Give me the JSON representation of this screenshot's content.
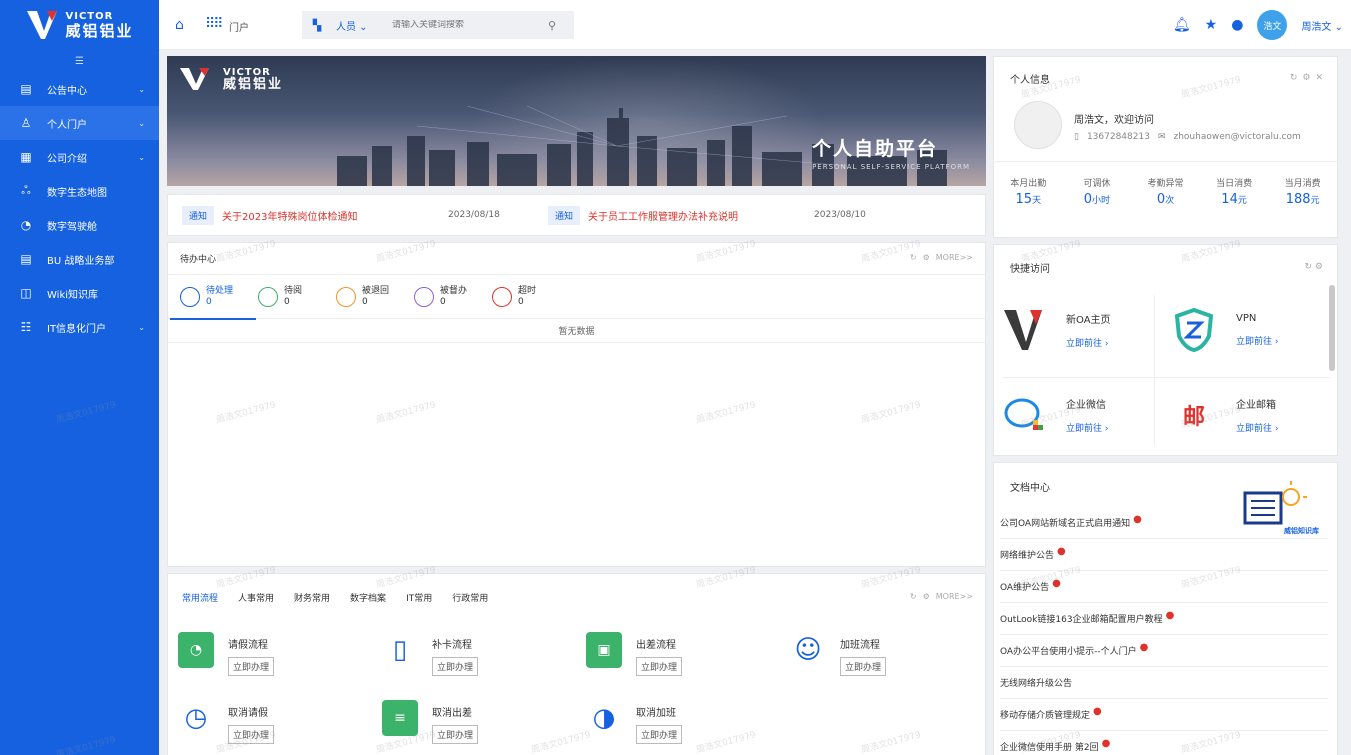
{
  "brand": {
    "en": "VICTOR",
    "cn": "威铝铝业"
  },
  "sidebar": {
    "items": [
      {
        "label": "公告中心",
        "icon": "▤",
        "expandable": true
      },
      {
        "label": "个人门户",
        "icon": "♙",
        "expandable": true,
        "active": true
      },
      {
        "label": "公司介绍",
        "icon": "▦",
        "expandable": true
      },
      {
        "label": "数字生态地图",
        "icon": "ஃ",
        "expandable": false
      },
      {
        "label": "数字驾驶舱",
        "icon": "◔",
        "expandable": false
      },
      {
        "label": "BU 战略业务部",
        "icon": "▤",
        "expandable": false
      },
      {
        "label": "Wiki知识库",
        "icon": "◫",
        "expandable": false
      },
      {
        "label": "IT信息化门户",
        "icon": "☷",
        "expandable": true
      }
    ]
  },
  "topbar": {
    "portal_label": "门户",
    "search_scope": "人员",
    "search_placeholder": "请输入关键词搜索",
    "avatar_text": "浩文",
    "user_name": "周浩文"
  },
  "banner": {
    "logo_en": "VICTOR",
    "logo_cn": "威铝铝业",
    "title": "个人自助平台",
    "subtitle": "PERSONAL SELF-SERVICE PLATFORM"
  },
  "notices": [
    {
      "tag": "通知",
      "title": "关于2023年特殊岗位体检通知",
      "date": "2023/08/18"
    },
    {
      "tag": "通知",
      "title": "关于员工工作服管理办法补充说明",
      "date": "2023/08/10"
    }
  ],
  "todo": {
    "title": "待办中心",
    "more": "MORE>>",
    "tabs": [
      {
        "label": "待处理",
        "count": "0",
        "color": "#1561e0"
      },
      {
        "label": "待阅",
        "count": "0",
        "color": "#3bb36a"
      },
      {
        "label": "被退回",
        "count": "0",
        "color": "#f0962b"
      },
      {
        "label": "被督办",
        "count": "0",
        "color": "#8a63d2"
      },
      {
        "label": "超时",
        "count": "0",
        "color": "#e0322c"
      }
    ],
    "empty_text": "暂无数据"
  },
  "flows": {
    "more": "MORE>>",
    "tabs": [
      "常用流程",
      "人事常用",
      "财务常用",
      "数字档案",
      "IT常用",
      "行政常用"
    ],
    "items": [
      {
        "name": "请假流程",
        "btn": "立即办理",
        "color": "#3bb36a",
        "icon": "◔"
      },
      {
        "name": "补卡流程",
        "btn": "立即办理",
        "color": "#ffffff",
        "icon": "▯"
      },
      {
        "name": "出差流程",
        "btn": "立即办理",
        "color": "#3bb36a",
        "icon": "▣"
      },
      {
        "name": "加班流程",
        "btn": "立即办理",
        "color": "#ffffff",
        "icon": "☺"
      },
      {
        "name": "取消请假",
        "btn": "立即办理",
        "color": "#ffffff",
        "icon": "◷"
      },
      {
        "name": "取消出差",
        "btn": "立即办理",
        "color": "#3bb36a",
        "icon": "≡"
      },
      {
        "name": "取消加班",
        "btn": "立即办理",
        "color": "#ffffff",
        "icon": "◑"
      }
    ]
  },
  "profile": {
    "title": "个人信息",
    "welcome": "周浩文，欢迎访问",
    "phone": "13672848213",
    "email": "zhouhaowen@victoralu.com",
    "stats": [
      {
        "label": "本月出勤",
        "value": "15",
        "unit": "天"
      },
      {
        "label": "可调休",
        "value": "0",
        "unit": "小时"
      },
      {
        "label": "考勤异常",
        "value": "0",
        "unit": "次"
      },
      {
        "label": "当日消费",
        "value": "14",
        "unit": "元"
      },
      {
        "label": "当月消费",
        "value": "188",
        "unit": "元"
      }
    ]
  },
  "quick": {
    "title": "快捷访问",
    "items": [
      {
        "name": "新OA主页",
        "go": "立即前往 ›",
        "icon": "V"
      },
      {
        "name": "VPN",
        "go": "立即前往 ›",
        "icon": "Z"
      },
      {
        "name": "企业微信",
        "go": "立即前往 ›",
        "icon": "◯"
      },
      {
        "name": "企业邮箱",
        "go": "立即前往 ›",
        "icon": "邮"
      }
    ]
  },
  "docs": {
    "title": "文档中心",
    "kb_label": "威铝知识库",
    "items": [
      {
        "title": "公司OA网站新域名正式启用通知",
        "dot": true
      },
      {
        "title": "网络维护公告",
        "dot": true
      },
      {
        "title": "OA维护公告",
        "dot": true
      },
      {
        "title": "OutLook链接163企业邮箱配置用户教程",
        "dot": true
      },
      {
        "title": "OA办公平台使用小提示--个人门户",
        "dot": true
      },
      {
        "title": "无线网络升级公告",
        "dot": false
      },
      {
        "title": "移动存储介质管理规定",
        "dot": true
      },
      {
        "title": "企业微信使用手册 第2回",
        "dot": true
      }
    ]
  },
  "watermark": "周浩文017979"
}
